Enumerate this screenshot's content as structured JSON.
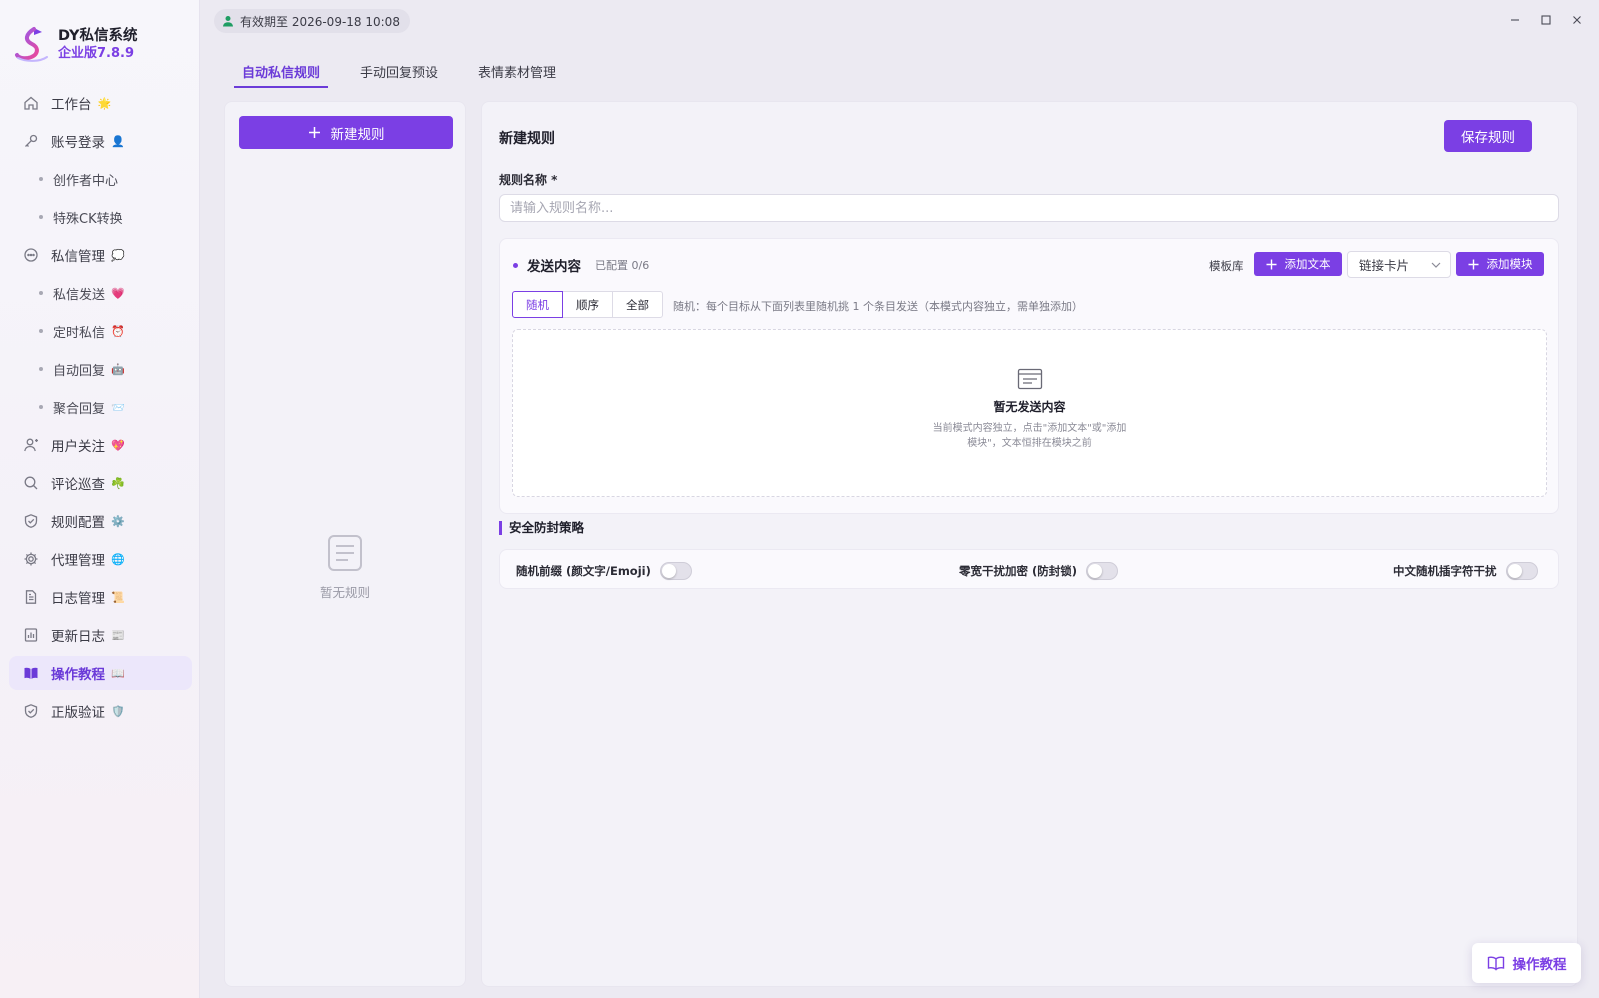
{
  "app": {
    "title": "DY私信系统",
    "edition": "企业版7.8.9",
    "expire": "有效期至 2026-09-18 10:08"
  },
  "sidebar": {
    "items": [
      {
        "label": "工作台",
        "icon": "home-icon",
        "emoji": "🌟",
        "sub": false
      },
      {
        "label": "账号登录",
        "icon": "key-icon",
        "emoji": "👤",
        "sub": false
      },
      {
        "label": "创作者中心",
        "sub": true
      },
      {
        "label": "特殊CK转换",
        "sub": true
      },
      {
        "label": "私信管理",
        "icon": "chat-icon",
        "emoji": "💭",
        "sub": false
      },
      {
        "label": "私信发送",
        "sub": true,
        "emoji": "💗"
      },
      {
        "label": "定时私信",
        "sub": true,
        "emoji": "⏰"
      },
      {
        "label": "自动回复",
        "sub": true,
        "emoji": "🤖"
      },
      {
        "label": "聚合回复",
        "sub": true,
        "emoji": "📨"
      },
      {
        "label": "用户关注",
        "icon": "user-follow-icon",
        "emoji": "💖",
        "sub": false
      },
      {
        "label": "评论巡查",
        "icon": "search-icon",
        "emoji": "☘️",
        "sub": false
      },
      {
        "label": "规则配置",
        "icon": "shield-check-icon",
        "emoji": "⚙️",
        "sub": false
      },
      {
        "label": "代理管理",
        "icon": "gear-icon",
        "emoji": "🌐",
        "sub": false
      },
      {
        "label": "日志管理",
        "icon": "document-icon",
        "emoji": "📜",
        "sub": false
      },
      {
        "label": "更新日志",
        "icon": "chart-doc-icon",
        "emoji": "📰",
        "sub": false
      },
      {
        "label": "操作教程",
        "icon": "book-icon",
        "emoji": "📖",
        "sub": false,
        "active": true
      },
      {
        "label": "正版验证",
        "icon": "shield-check-icon",
        "emoji": "🛡️",
        "sub": false
      }
    ]
  },
  "tabs": [
    {
      "label": "自动私信规则",
      "active": true
    },
    {
      "label": "手动回复预设",
      "active": false
    },
    {
      "label": "表情素材管理",
      "active": false
    }
  ],
  "rules_panel": {
    "new_rule_button": "新建规则",
    "empty_text": "暂无规则"
  },
  "editor": {
    "title": "新建规则",
    "save_button": "保存规则",
    "name_label": "规则名称 *",
    "name_placeholder": "请输入规则名称...",
    "name_value": "",
    "send": {
      "title": "发送内容",
      "count": "已配置 0/6",
      "template_lib": "模板库",
      "add_text": "添加文本",
      "link_card": "链接卡片",
      "add_module": "添加模块",
      "modes": [
        "随机",
        "顺序",
        "全部"
      ],
      "selected_mode": "随机",
      "mode_hint": "随机：每个目标从下面列表里随机挑 1 个条目发送（本模式内容独立，需单独添加）",
      "empty_title": "暂无发送内容",
      "empty_desc": "当前模式内容独立，点击\"添加文本\"或\"添加模块\"，文本恒排在模块之前"
    },
    "security": {
      "title": "安全防封策略",
      "options": [
        {
          "label": "随机前缀 (颜文字/Emoji)",
          "enabled": false
        },
        {
          "label": "零宽干扰加密 (防封锁)",
          "enabled": false
        },
        {
          "label": "中文随机插字符干扰",
          "enabled": false
        }
      ]
    }
  },
  "floating_help": {
    "label": "操作教程"
  },
  "colors": {
    "accent": "#7b3fe4",
    "active_bg": "#ece7fb"
  }
}
